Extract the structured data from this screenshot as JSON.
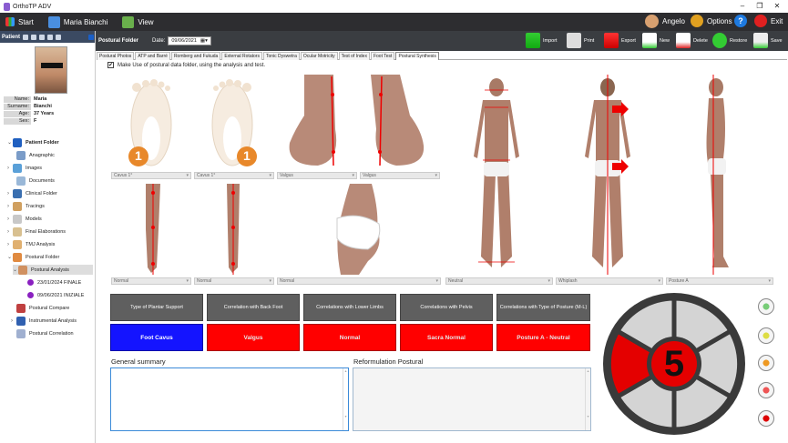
{
  "app": {
    "title": "OrthoTP ADV"
  },
  "menubar": {
    "start": "Start",
    "patient_name": "Maria Bianchi",
    "view": "View",
    "user": "Angelo",
    "options": "Options",
    "help": "?",
    "exit": "Exit"
  },
  "sidebar": {
    "header": "Patient",
    "info": [
      {
        "label": "Name:",
        "value": "Maria"
      },
      {
        "label": "Surname:",
        "value": "Bianchi"
      },
      {
        "label": "Age:",
        "value": "37 Years"
      },
      {
        "label": "Sex:",
        "value": "F"
      }
    ],
    "tree": [
      {
        "label": "Patient Folder",
        "bold": true
      },
      {
        "label": "Anagraphic"
      },
      {
        "label": "Images"
      },
      {
        "label": "Documents"
      },
      {
        "label": "Clinical Folder"
      },
      {
        "label": "Tracings"
      },
      {
        "label": "Models"
      },
      {
        "label": "Final Elaborations"
      },
      {
        "label": "TMJ Analysis"
      },
      {
        "label": "Postural Folder"
      },
      {
        "label": "Postural Analysis"
      },
      {
        "label": "23/01/2024 FINALE"
      },
      {
        "label": "09/06/2021 INIZIALE"
      },
      {
        "label": "Postural Compare"
      },
      {
        "label": "Instrumental Analysis"
      },
      {
        "label": "Postural Correlation"
      }
    ]
  },
  "toolbar": {
    "section": "Postural Folder",
    "date_label": "Date:",
    "date_value": "09/06/2021",
    "import": "Import",
    "print": "Print",
    "export": "Export",
    "new": "New",
    "delete": "Delete",
    "restore": "Restore",
    "save": "Save"
  },
  "tabs": [
    "Postural Photos",
    "ATP and Barré",
    "Romberg and Fukuda",
    "External Rotators",
    "Tonic Dyswetra",
    "Ocular Motricity",
    "Test of Index",
    "Foot Test",
    "Postural Synthesis"
  ],
  "active_tab": "Postural Synthesis",
  "checkbox": {
    "label": "Make Use of postural data folder, using the analysis and test.",
    "checked": true
  },
  "selectors_row1": [
    "Cavus 1°",
    "Cavus 1°",
    "Valgus",
    "Valgus"
  ],
  "badges": [
    "1",
    "1"
  ],
  "selectors_row2": [
    "Normal",
    "Normal",
    "Normal",
    "Neutral",
    "Whiplash",
    "Posture A"
  ],
  "categories": [
    "Type of Plantar Support",
    "Correlation with Back Foot",
    "Correlations with Lower Limbs",
    "Correlations with Pelvis",
    "Correlations with Type of Posture (M-L)"
  ],
  "results": [
    "Foot Cavus",
    "Valgus",
    "Normal",
    "Sacra Normal",
    "Posture A - Neutral"
  ],
  "result_colors": [
    "#1414ff",
    "#ff0000",
    "#ff0000",
    "#ff0000",
    "#ff0000"
  ],
  "general_summary": {
    "label": "General summary",
    "value": ""
  },
  "reformulation": {
    "label": "Reformulation Postural",
    "value": ""
  },
  "score": {
    "value": "5",
    "highlighted_segment": "left-top"
  }
}
